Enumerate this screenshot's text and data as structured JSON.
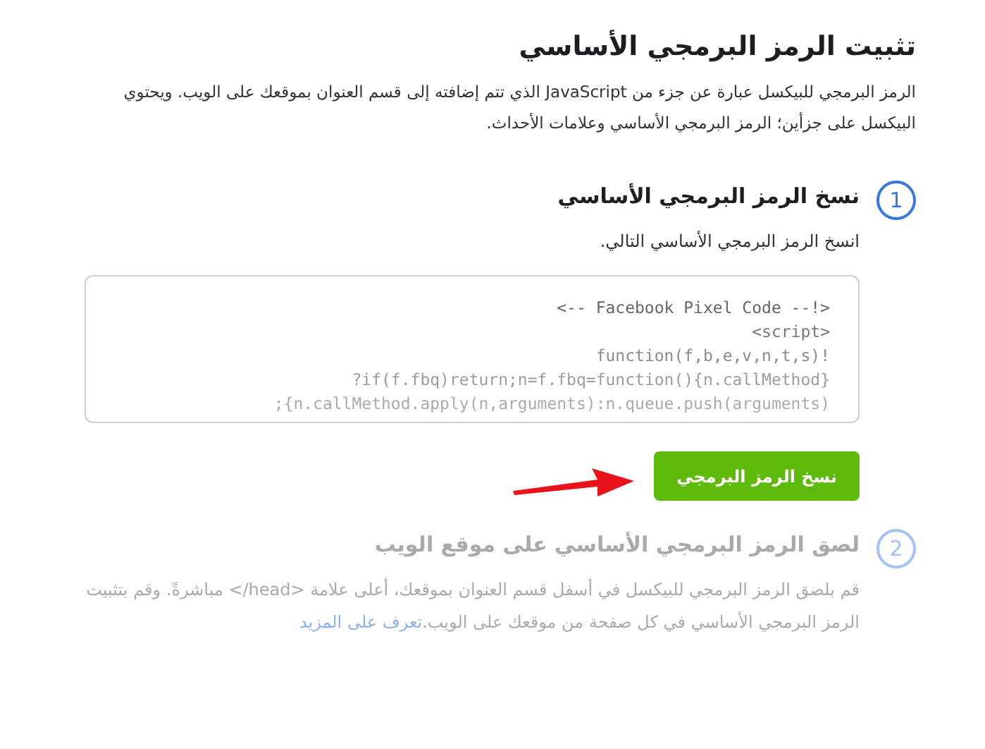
{
  "title": "تثبيت الرمز البرمجي الأساسي",
  "intro": "الرمز البرمجي للبيكسل عبارة عن جزء من JavaScript الذي تتم إضافته إلى قسم العنوان بموقعك على الويب. ويحتوي البيكسل على جزأين؛ الرمز البرمجي الأساسي وعلامات الأحداث.",
  "steps": [
    {
      "number": "1",
      "title": "نسخ الرمز البرمجي الأساسي",
      "active": true,
      "description": "انسخ الرمز البرمجي الأساسي التالي.",
      "code_lines": [
        "<-- Facebook Pixel Code --!>",
        "<script>",
        "function(f,b,e,v,n,t,s)!",
        "?if(f.fbq)return;n=f.fbq=function(){n.callMethod}",
        ";{n.callMethod.apply(n,arguments):n.queue.push(arguments)"
      ],
      "button": "نسخ الرمز البرمجي"
    },
    {
      "number": "2",
      "title": "لصق الرمز البرمجي الأساسي على موقع الويب",
      "active": false,
      "description": "قم بلصق الرمز البرمجي للبيكسل في أسفل قسم العنوان بموقعك، أعلى علامة <head/> مباشرةً. وقم بتثبيت الرمز البرمجي الأساسي في كل صفحة من موقعك على الويب.",
      "link": "تعرف على المزيد"
    }
  ]
}
